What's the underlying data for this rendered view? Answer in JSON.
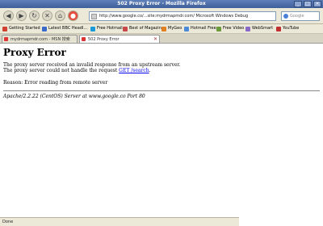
{
  "window": {
    "title": "502 Proxy Error - Mozilla Firefox"
  },
  "navbar": {
    "url": "http://www.google.co/...site:mydrmapmdr.com/  Microsoft Windows Debug",
    "search_placeholder": "Google"
  },
  "bookmarks": [
    {
      "label": "Getting Started",
      "color": "#d04030"
    },
    {
      "label": "Latest BBC Headl...",
      "color": "#3a6ac8"
    },
    {
      "label": "Free Hotmail",
      "color": "#1a9ad8"
    },
    {
      "label": "Best of Magazine",
      "color": "#c84848"
    },
    {
      "label": "MyGeo",
      "color": "#e08020"
    },
    {
      "label": "Hotmail Free",
      "color": "#4a8ad8"
    },
    {
      "label": "Free Video",
      "color": "#6a9a3a"
    },
    {
      "label": "WebSmart",
      "color": "#8a6ac8"
    },
    {
      "label": "YouTube",
      "color": "#c03030"
    }
  ],
  "tabs": [
    {
      "label": "mydrmapmdr.com - MSN 搜索",
      "active": false
    },
    {
      "label": "502 Proxy Error",
      "active": true
    }
  ],
  "page": {
    "heading": "Proxy Error",
    "para1_line1": "The proxy server received an invalid response from an upstream server.",
    "para1_line2_prefix": "The proxy server could not handle the request ",
    "para1_link": "GET /search",
    "para1_suffix": ".",
    "reason": "Reason: Error reading from remote server",
    "address": "Apache/2.2.22 (CentOS) Server at www.google.co Port 80"
  },
  "status": {
    "text": "Done"
  }
}
